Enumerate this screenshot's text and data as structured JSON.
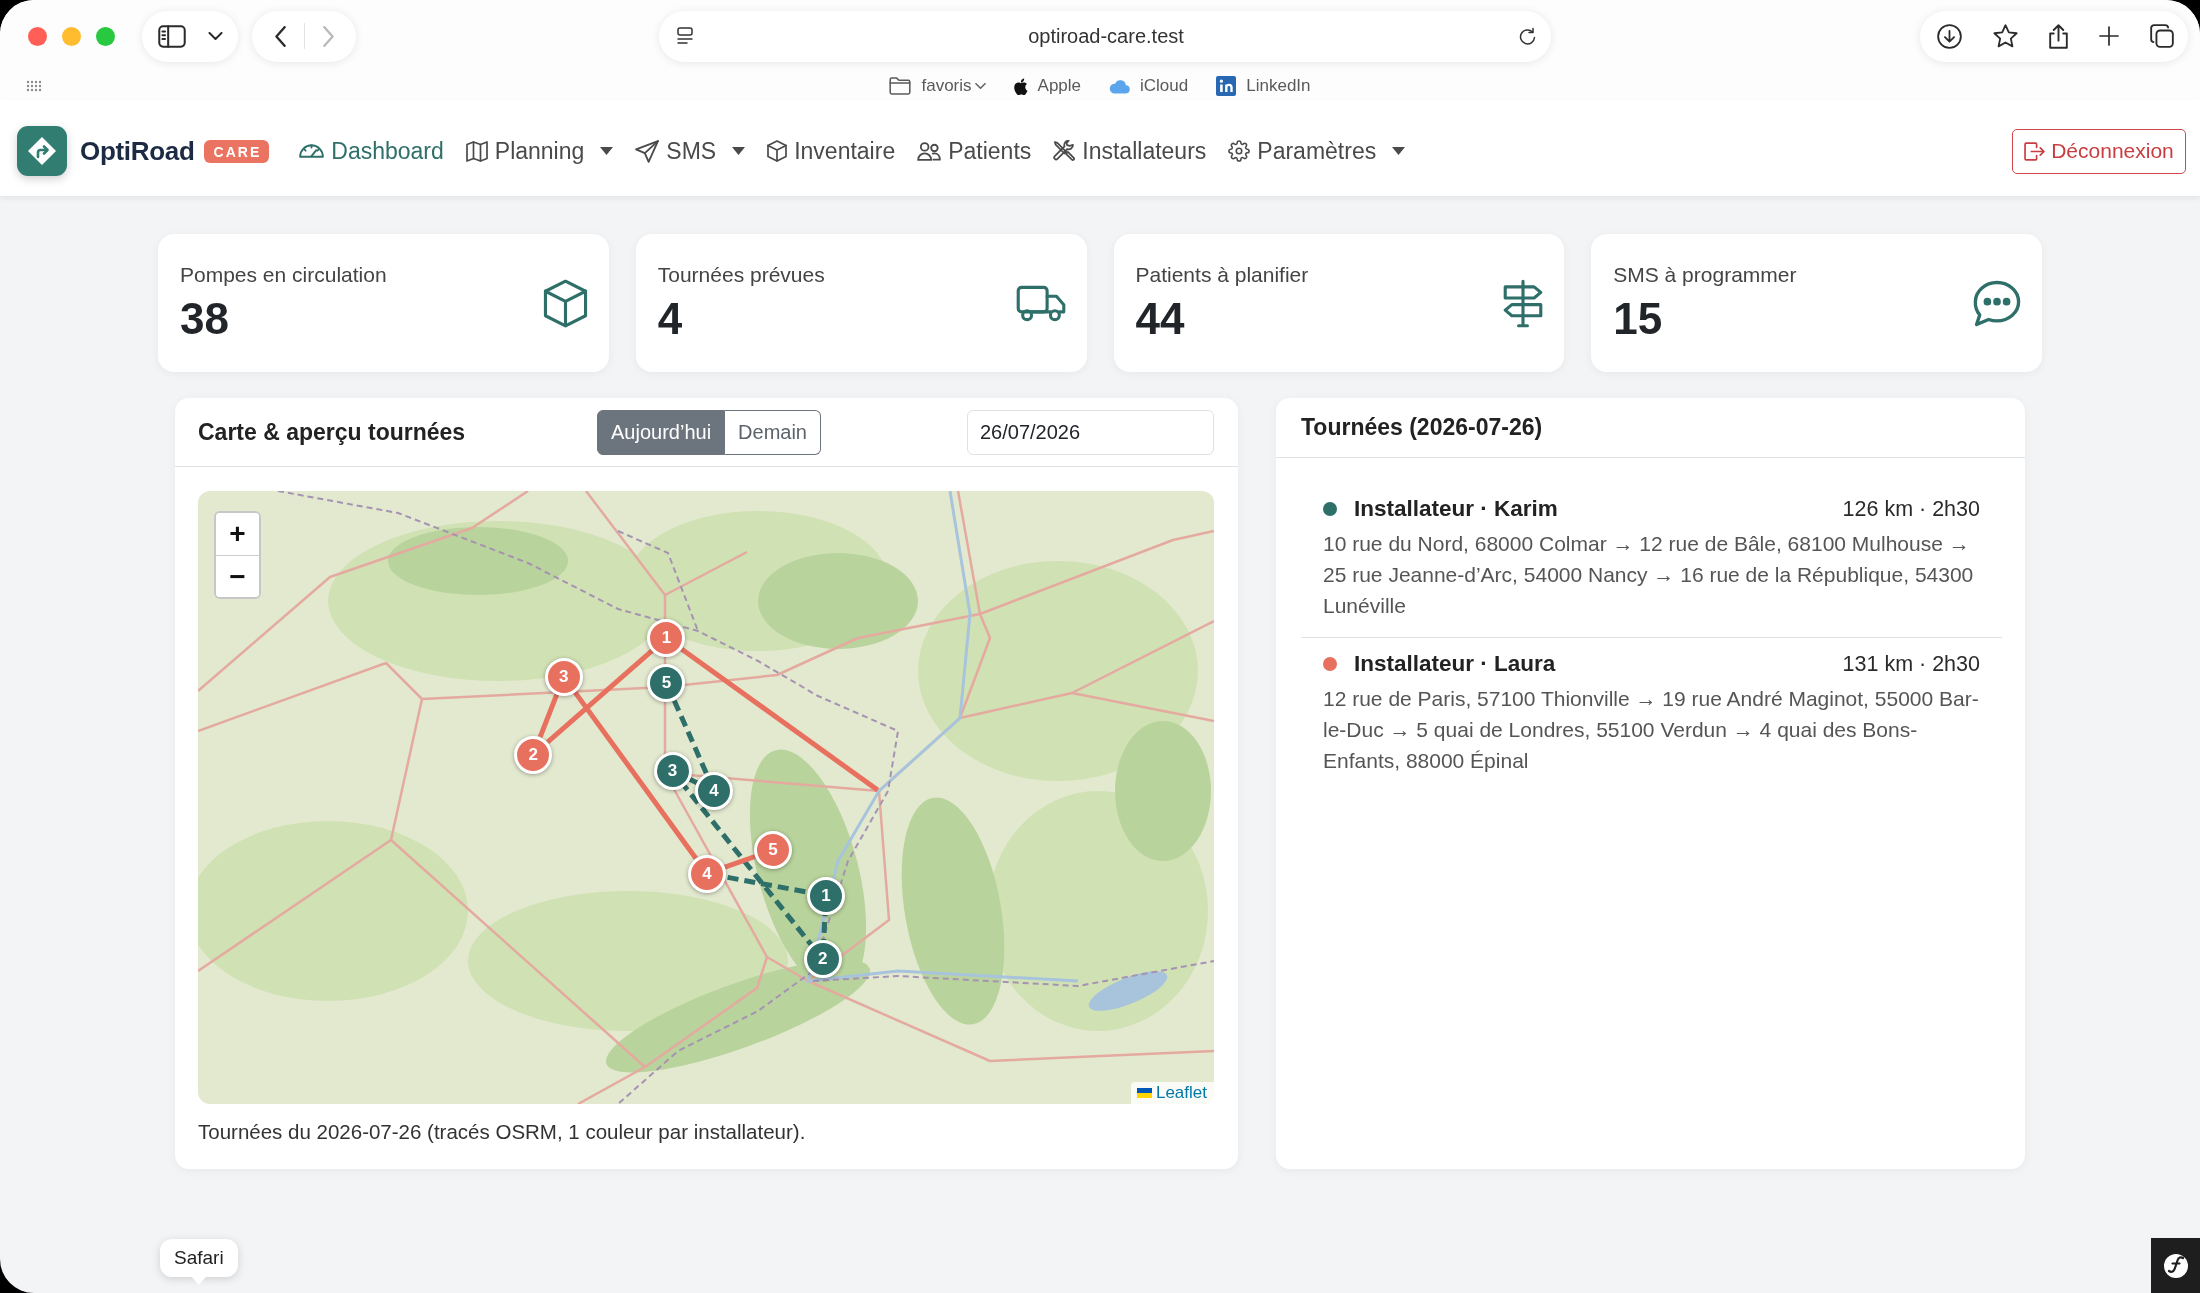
{
  "browser": {
    "forward_disabled": true,
    "address": "optiroad-care.test",
    "favorites": [
      {
        "label": "favoris",
        "kind": "folder"
      },
      {
        "label": "Apple",
        "kind": "bookmark"
      },
      {
        "label": "iCloud",
        "kind": "bookmark"
      },
      {
        "label": "LinkedIn",
        "kind": "bookmark"
      }
    ]
  },
  "navbar": {
    "brand": "OptiRoad",
    "badge": "CARE",
    "items": [
      {
        "label": "Dashboard",
        "selected": true,
        "dropdown": false
      },
      {
        "label": "Planning",
        "selected": false,
        "dropdown": true
      },
      {
        "label": "SMS",
        "selected": false,
        "dropdown": true
      },
      {
        "label": "Inventaire",
        "selected": false,
        "dropdown": false
      },
      {
        "label": "Patients",
        "selected": false,
        "dropdown": false
      },
      {
        "label": "Installateurs",
        "selected": false,
        "dropdown": false
      },
      {
        "label": "Paramètres",
        "selected": false,
        "dropdown": true
      }
    ],
    "logout": "Déconnexion"
  },
  "stats": [
    {
      "label": "Pompes en circulation",
      "value": "38"
    },
    {
      "label": "Tournées prévues",
      "value": "4"
    },
    {
      "label": "Patients à planifier",
      "value": "44"
    },
    {
      "label": "SMS à programmer",
      "value": "15"
    }
  ],
  "map_card": {
    "title": "Carte & aperçu tournées",
    "day_tabs": [
      {
        "label": "Aujourd’hui",
        "selected": true
      },
      {
        "label": "Demain",
        "selected": false
      }
    ],
    "date": "26/07/2026",
    "zoom_in": "+",
    "zoom_out": "−",
    "routes": [
      {
        "color": "#2e6f69",
        "dashed": true,
        "markers": [
          "1",
          "2",
          "3",
          "4",
          "5"
        ]
      },
      {
        "color": "#e8705e",
        "dashed": false,
        "markers": [
          "1",
          "2",
          "3",
          "4",
          "5"
        ]
      }
    ],
    "attribution": "Leaflet",
    "caption": "Tournées du 2026-07-26 (tracés OSRM, 1 couleur par installateur)."
  },
  "tours_card": {
    "title": "Tournées (2026-07-26)",
    "tours": [
      {
        "name": "Installateur · Karim",
        "summary": "126 km · 2h30",
        "color": "#2e6f69",
        "stops": "10 rue du Nord, 68000 Colmar → 12 rue de Bâle, 68100 Mulhouse → 25 rue Jeanne-d’Arc, 54000 Nancy → 16 rue de la République, 54300 Lunéville"
      },
      {
        "name": "Installateur · Laura",
        "summary": "131 km · 2h30",
        "color": "#e8705e",
        "stops": "12 rue de Paris, 57100 Thionville → 19 rue André Maginot, 55000 Bar-le-Duc → 5 quai de Londres, 55100 Verdun → 4 quai des Bons-Enfants, 88000 Épinal"
      }
    ]
  },
  "dock_tooltip": "Safari"
}
